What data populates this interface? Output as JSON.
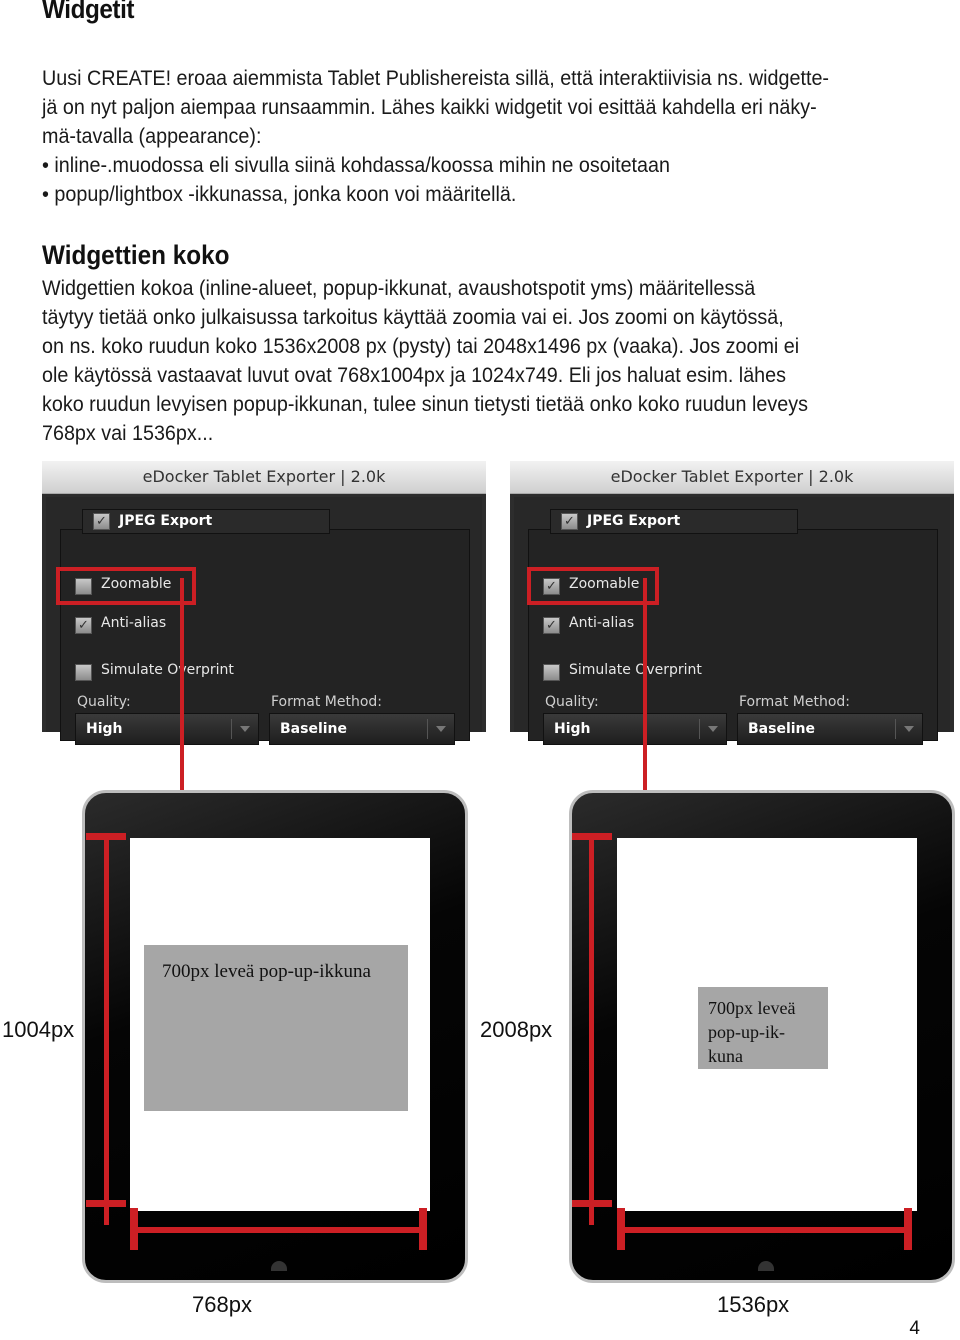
{
  "heading": "Widgetit",
  "intro_lines": [
    "Uusi CREATE! eroaa aiemmista Tablet Publishereista sillä, että interaktiivisia ns. widgette-",
    "jä on nyt paljon aiempaa runsaammin. Lähes kaikki widgetit voi esittää kahdella eri näky-",
    "mä-tavalla (appearance):",
    "• inline-.muodossa eli sivulla siinä kohdassa/koossa mihin ne osoitetaan",
    "• popup/lightbox -ikkunassa, jonka koon voi määritellä."
  ],
  "subheading": "Widgettien koko",
  "size_lines": [
    "Widgettien kokoa (inline-alueet, popup-ikkunat, avaushotspotit yms) määritellessä",
    "täytyy tietää onko julkaisussa tarkoitus käyttää zoomia vai ei. Jos zoomi on käytössä,",
    "on ns. koko ruudun koko 1536x2008 px (pysty) tai 2048x1496 px (vaaka). Jos zoomi ei",
    "ole käytössä vastaavat luvut ovat 768x1004px ja 1024x749. Eli jos haluat esim. lähes",
    "koko ruudun levyisen popup-ikkunan, tulee sinun tietysti tietää onko koko ruudun leveys",
    "768px vai 1536px..."
  ],
  "exporters": [
    {
      "title": "eDocker Tablet Exporter | 2.0k",
      "group_label": "JPEG Export",
      "group_checked": "✓",
      "zoomable_label": "Zoomable",
      "zoomable_checked": "",
      "antialias_label": "Anti-alias",
      "antialias_checked": "✓",
      "overprint_label": "Simulate Overprint",
      "overprint_checked": "",
      "quality_label": "Quality:",
      "quality_value": "High",
      "format_label": "Format Method:",
      "format_value": "Baseline"
    },
    {
      "title": "eDocker Tablet Exporter | 2.0k",
      "group_label": "JPEG Export",
      "group_checked": "✓",
      "zoomable_label": "Zoomable",
      "zoomable_checked": "✓",
      "antialias_label": "Anti-alias",
      "antialias_checked": "✓",
      "overprint_label": "Simulate Overprint",
      "overprint_checked": "",
      "quality_label": "Quality:",
      "quality_value": "High",
      "format_label": "Format Method:",
      "format_value": "Baseline"
    }
  ],
  "tablets": [
    {
      "height_label": "1004px",
      "width_label": "768px",
      "popup_text": "700px leveä pop-up-ikkuna"
    },
    {
      "height_label": "2008px",
      "width_label": "1536px",
      "popup_lines": [
        "700px leveä",
        "pop-up-ik-",
        "kuna"
      ]
    }
  ],
  "accent_color": "#cc1f24",
  "page_number": "4"
}
